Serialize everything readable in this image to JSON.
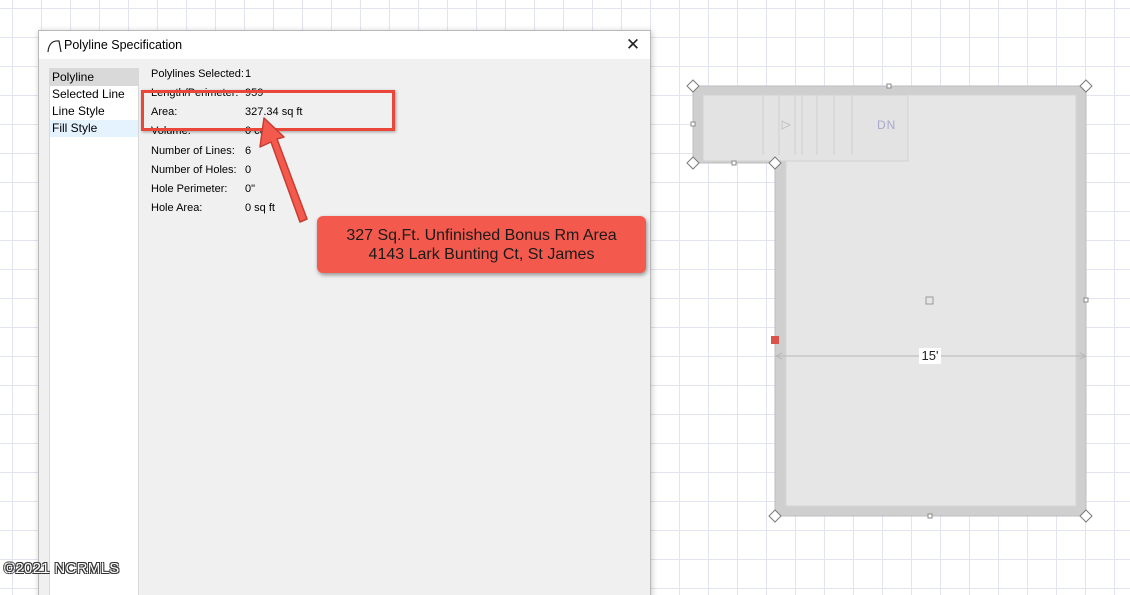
{
  "dialog": {
    "title": "Polyline Specification",
    "close_symbol": "✕",
    "nav_items": [
      {
        "label": "Polyline"
      },
      {
        "label": "Selected Line"
      },
      {
        "label": "Line Style"
      },
      {
        "label": "Fill Style"
      }
    ],
    "properties": [
      {
        "label": "Polylines Selected:",
        "value": "1"
      },
      {
        "label": "Length/Perimeter:",
        "value": "959"
      },
      {
        "label": "Area:",
        "value": "327.34 sq ft"
      },
      {
        "label": "Volume:",
        "value": "0 cu ft"
      },
      {
        "label": "Number of Lines:",
        "value": "6"
      },
      {
        "label": "Number of Holes:",
        "value": "0"
      },
      {
        "label": "Hole Perimeter:",
        "value": "0\""
      },
      {
        "label": "Hole Area:",
        "value": "0 sq ft"
      }
    ]
  },
  "callout": {
    "line1": "327 Sq.Ft. Unfinished Bonus Rm Area",
    "line2": "4143 Lark Bunting Ct, St James"
  },
  "plan": {
    "dimension_label": "15'",
    "stair_label": "DN"
  },
  "watermark": "©2021 NCRMLS",
  "colors": {
    "annotation_red": "#e8473a",
    "callout_fill": "#f35a4d",
    "plan_fill": "#e5e5e5",
    "plan_wall": "#cdcdcd"
  },
  "icons": {
    "app": "polyline-arc-icon",
    "close": "close-icon"
  }
}
